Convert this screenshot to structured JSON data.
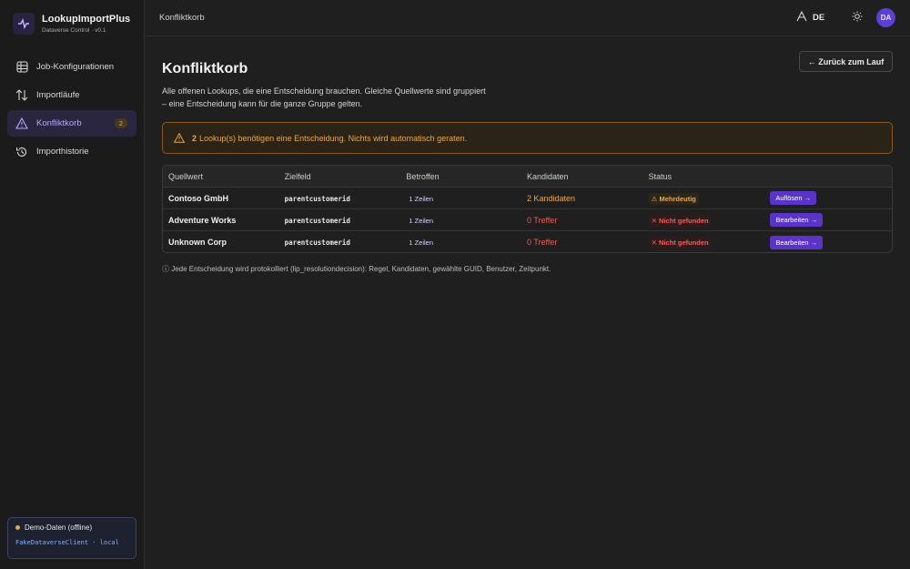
{
  "app": {
    "title": "LookupImportPlus",
    "subtitle": "Dataverse Control · v0.1"
  },
  "sidebar": {
    "items": [
      {
        "label": "Job-Konfigurationen",
        "icon": "grid-icon"
      },
      {
        "label": "Importläufe",
        "icon": "arrows-updown-icon"
      },
      {
        "label": "Konfliktkorb",
        "icon": "warning-icon",
        "badge": "2",
        "active": true
      },
      {
        "label": "Importhistorie",
        "icon": "history-icon"
      }
    ],
    "demo": {
      "label": "Demo-Daten (offline)",
      "client": "FakeDataverseClient · local"
    }
  },
  "header": {
    "breadcrumb": "Konfliktkorb",
    "lang": "DE",
    "avatar": "DA"
  },
  "main": {
    "title": "Konfliktkorb",
    "back_label": "← Zurück zum Lauf",
    "description": "Alle offenen Lookups, die eine Entscheidung brauchen. Gleiche Quellwerte sind gruppiert – eine Entscheidung kann für die ganze Gruppe gelten.",
    "warning_count": "2",
    "warning_text": "Lookup(s) benötigen eine Entscheidung. Nichts wird automatisch geraten.",
    "table": {
      "headers": [
        "Quellwert",
        "Zielfeld",
        "Betroffen",
        "Kandidaten",
        "Status",
        ""
      ],
      "rows": [
        {
          "source": "Contoso GmbH",
          "field": "parentcustomerid",
          "affected": "1 Zeilen",
          "candidates": "2 Kandidaten",
          "status": "⚠ Mehrdeutig",
          "action": "Auflösen →"
        },
        {
          "source": "Adventure Works",
          "field": "parentcustomerid",
          "affected": "1 Zeilen",
          "candidates": "0 Treffer",
          "status": "✕ Nicht gefunden",
          "action": "Bearbeiten →"
        },
        {
          "source": "Unknown Corp",
          "field": "parentcustomerid",
          "affected": "1 Zeilen",
          "candidates": "0 Treffer",
          "status": "✕ Nicht gefunden",
          "action": "Bearbeiten →"
        }
      ]
    },
    "footnote": "ⓘ Jede Entscheidung wird protokolliert (lip_resolutiondecision): Regel, Kandidaten, gewählte GUID, Benutzer, Zeitpunkt."
  },
  "colors": {
    "accent": "#5a34c8",
    "warning": "#e8a94a",
    "error": "#e0605a",
    "background": "#1f1f1f"
  }
}
